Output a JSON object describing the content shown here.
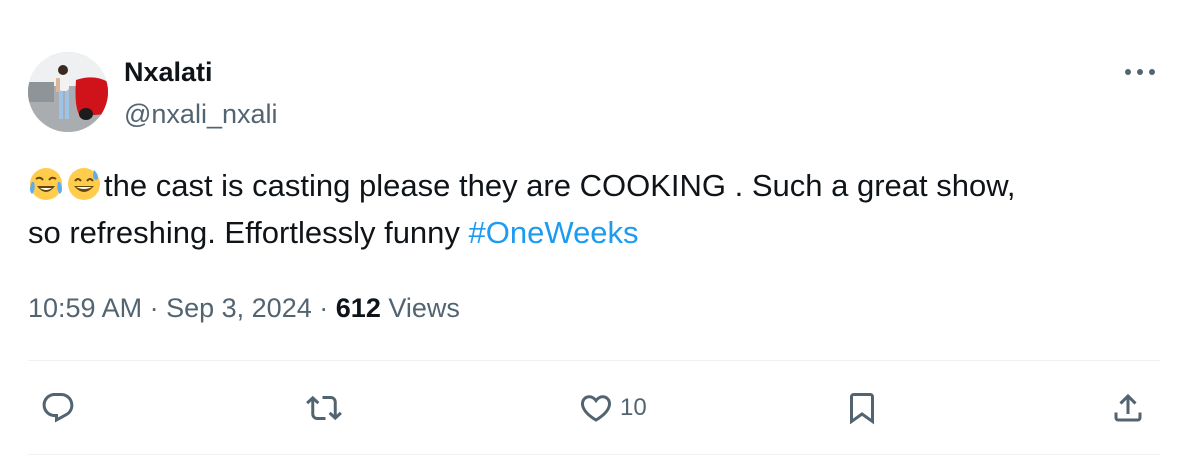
{
  "author": {
    "display_name": "Nxalati",
    "handle": "@nxali_nxali"
  },
  "tweet": {
    "emojis": [
      "face-with-tears-of-joy-emoji",
      "grinning-face-with-sweat-emoji"
    ],
    "text_line1": "the cast is casting please they are COOKING . Such a great show,",
    "text_line2": "so refreshing. Effortlessly funny ",
    "hashtag": "#OneWeeks"
  },
  "meta": {
    "time": "10:59 AM",
    "separator": "·",
    "date": "Sep 3, 2024",
    "views_count": "612",
    "views_label": "Views"
  },
  "actions": {
    "reply_icon": "reply-icon",
    "retweet_icon": "retweet-icon",
    "like_icon": "heart-icon",
    "like_count": "10",
    "bookmark_icon": "bookmark-icon",
    "share_icon": "share-icon",
    "more_icon": "more-horizontal-icon"
  },
  "colors": {
    "text_primary": "#0f1419",
    "text_secondary": "#536471",
    "link": "#1d9bf0",
    "divider": "#eff3f4"
  }
}
